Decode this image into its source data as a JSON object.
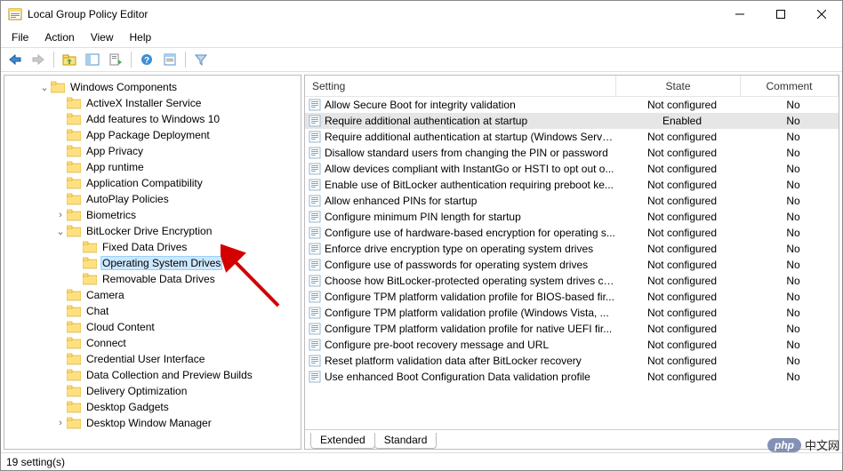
{
  "window": {
    "title": "Local Group Policy Editor"
  },
  "menu": {
    "file": "File",
    "action": "Action",
    "view": "View",
    "help": "Help"
  },
  "tree": {
    "root": "Windows Components",
    "items": [
      {
        "indent": 3,
        "label": "ActiveX Installer Service"
      },
      {
        "indent": 3,
        "label": "Add features to Windows 10"
      },
      {
        "indent": 3,
        "label": "App Package Deployment"
      },
      {
        "indent": 3,
        "label": "App Privacy"
      },
      {
        "indent": 3,
        "label": "App runtime"
      },
      {
        "indent": 3,
        "label": "Application Compatibility"
      },
      {
        "indent": 3,
        "label": "AutoPlay Policies"
      },
      {
        "indent": 3,
        "label": "Biometrics",
        "toggle": ">"
      },
      {
        "indent": 3,
        "label": "BitLocker Drive Encryption",
        "toggle": "v"
      },
      {
        "indent": 4,
        "label": "Fixed Data Drives"
      },
      {
        "indent": 4,
        "label": "Operating System Drives",
        "selected": true
      },
      {
        "indent": 4,
        "label": "Removable Data Drives"
      },
      {
        "indent": 3,
        "label": "Camera"
      },
      {
        "indent": 3,
        "label": "Chat"
      },
      {
        "indent": 3,
        "label": "Cloud Content"
      },
      {
        "indent": 3,
        "label": "Connect"
      },
      {
        "indent": 3,
        "label": "Credential User Interface"
      },
      {
        "indent": 3,
        "label": "Data Collection and Preview Builds"
      },
      {
        "indent": 3,
        "label": "Delivery Optimization"
      },
      {
        "indent": 3,
        "label": "Desktop Gadgets"
      },
      {
        "indent": 3,
        "label": "Desktop Window Manager",
        "toggle": ">"
      }
    ]
  },
  "list": {
    "headers": {
      "setting": "Setting",
      "state": "State",
      "comment": "Comment"
    },
    "rows": [
      {
        "setting": "Allow Secure Boot for integrity validation",
        "state": "Not configured",
        "comment": "No"
      },
      {
        "setting": "Require additional authentication at startup",
        "state": "Enabled",
        "comment": "No",
        "selected": true
      },
      {
        "setting": "Require additional authentication at startup (Windows Serve...",
        "state": "Not configured",
        "comment": "No"
      },
      {
        "setting": "Disallow standard users from changing the PIN or password",
        "state": "Not configured",
        "comment": "No"
      },
      {
        "setting": "Allow devices compliant with InstantGo or HSTI to opt out o...",
        "state": "Not configured",
        "comment": "No"
      },
      {
        "setting": "Enable use of BitLocker authentication requiring preboot ke...",
        "state": "Not configured",
        "comment": "No"
      },
      {
        "setting": "Allow enhanced PINs for startup",
        "state": "Not configured",
        "comment": "No"
      },
      {
        "setting": "Configure minimum PIN length for startup",
        "state": "Not configured",
        "comment": "No"
      },
      {
        "setting": "Configure use of hardware-based encryption for operating s...",
        "state": "Not configured",
        "comment": "No"
      },
      {
        "setting": "Enforce drive encryption type on operating system drives",
        "state": "Not configured",
        "comment": "No"
      },
      {
        "setting": "Configure use of passwords for operating system drives",
        "state": "Not configured",
        "comment": "No"
      },
      {
        "setting": "Choose how BitLocker-protected operating system drives ca...",
        "state": "Not configured",
        "comment": "No"
      },
      {
        "setting": "Configure TPM platform validation profile for BIOS-based fir...",
        "state": "Not configured",
        "comment": "No"
      },
      {
        "setting": "Configure TPM platform validation profile (Windows Vista, ...",
        "state": "Not configured",
        "comment": "No"
      },
      {
        "setting": "Configure TPM platform validation profile for native UEFI fir...",
        "state": "Not configured",
        "comment": "No"
      },
      {
        "setting": "Configure pre-boot recovery message and URL",
        "state": "Not configured",
        "comment": "No"
      },
      {
        "setting": "Reset platform validation data after BitLocker recovery",
        "state": "Not configured",
        "comment": "No"
      },
      {
        "setting": "Use enhanced Boot Configuration Data validation profile",
        "state": "Not configured",
        "comment": "No"
      }
    ]
  },
  "tabs": {
    "extended": "Extended",
    "standard": "Standard"
  },
  "status": {
    "text": "19 setting(s)"
  },
  "watermark": {
    "badge": "php",
    "text": "中文网"
  }
}
